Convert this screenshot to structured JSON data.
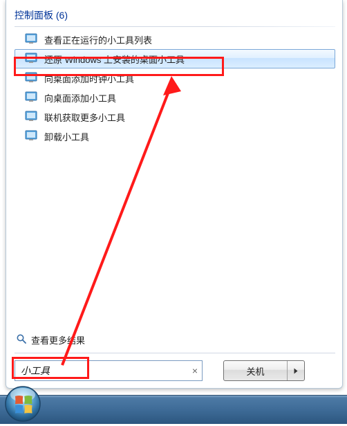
{
  "category": {
    "title": "控制面板",
    "count": "(6)"
  },
  "results": [
    {
      "label": "查看正在运行的小工具列表"
    },
    {
      "label": "还原 Windows 上安装的桌面小工具"
    },
    {
      "label": "向桌面添加时钟小工具"
    },
    {
      "label": "向桌面添加小工具"
    },
    {
      "label": "联机获取更多小工具"
    },
    {
      "label": "卸载小工具"
    }
  ],
  "more": {
    "label": "查看更多结果"
  },
  "search": {
    "value": "小工具",
    "clear": "×"
  },
  "shutdown": {
    "label": "关机"
  }
}
